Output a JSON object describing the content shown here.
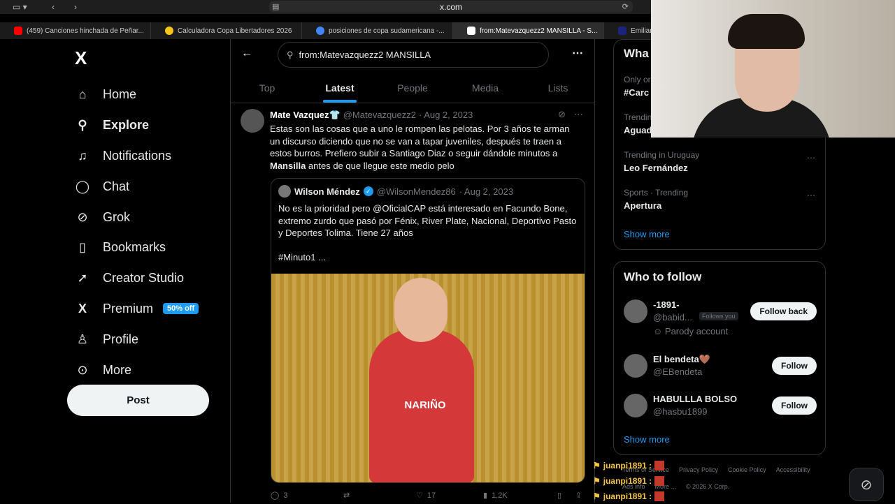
{
  "browser": {
    "url": "x.com",
    "tabs": [
      {
        "label": "(459) Canciones hinchada de Peñar...",
        "color": "#ff0000"
      },
      {
        "label": "Calculadora Copa Libertadores 2026",
        "color": "#f5c518"
      },
      {
        "label": "posiciones de copa sudamericana -...",
        "color": "#4285f4"
      },
      {
        "label": "from:Matevazquezz2 MANSILLA - S...",
        "color": "#ffffff"
      },
      {
        "label": "Emiliano",
        "color": "#1a237e"
      }
    ]
  },
  "nav": {
    "logo": "X",
    "items": [
      {
        "label": "Home",
        "icon": "home-icon",
        "glyph": "⌂"
      },
      {
        "label": "Explore",
        "icon": "search-icon",
        "glyph": "⚲"
      },
      {
        "label": "Notifications",
        "icon": "bell-icon",
        "glyph": "🔔"
      },
      {
        "label": "Chat",
        "icon": "chat-icon",
        "glyph": "◯"
      },
      {
        "label": "Grok",
        "icon": "grok-icon",
        "glyph": "⊘"
      },
      {
        "label": "Bookmarks",
        "icon": "bookmark-icon",
        "glyph": "▯"
      },
      {
        "label": "Creator Studio",
        "icon": "rocket-icon",
        "glyph": "➚"
      },
      {
        "label": "Premium",
        "icon": "x-premium-icon",
        "glyph": "X"
      },
      {
        "label": "Profile",
        "icon": "profile-icon",
        "glyph": "♙"
      },
      {
        "label": "More",
        "icon": "more-icon",
        "glyph": "⋯"
      }
    ],
    "premium_badge": "50% off",
    "post_label": "Post"
  },
  "search": {
    "query": "from:Matevazquezz2 MANSILLA"
  },
  "feed_tabs": [
    "Top",
    "Latest",
    "People",
    "Media",
    "Lists"
  ],
  "tweet": {
    "name": "Mate Vazquez👕",
    "handle": "@Matevazquezz2",
    "date": "· Aug 2, 2023",
    "text": "Estas son las cosas que a uno le rompen las pelotas. Por 3 años te arman un discurso diciendo que no se van a tapar juveniles, después te traen a estos burros. Prefiero subir a Santiago Diaz o seguir dándole minutos a ",
    "highlight": "Mansilla",
    "text_end": " antes de que llegue este medio pelo",
    "quote": {
      "name": "Wilson Méndez",
      "handle": "@WilsonMendez86",
      "date": "· Aug 2, 2023",
      "text1": "No es la prioridad pero @OficialCAP está interesado en Facundo Bone, extremo zurdo que  pasó por Fénix, River Plate, Nacional, Deportivo Pasto y Deportes Tolima. Tiene 27 años",
      "text2": "#Minuto1 ...",
      "image_text": "NARIÑO"
    },
    "replies": "3",
    "likes": "17",
    "views": "1.2K"
  },
  "trends": [
    {
      "sub": "Only on",
      "name": "#Carc"
    },
    {
      "sub": "Trending",
      "name": "Aguad"
    },
    {
      "sub": "Trending in Uruguay",
      "name": "Leo Fernández"
    },
    {
      "sub": "Sports · Trending",
      "name": "Apertura"
    }
  ],
  "whats_title": "Wha",
  "show_more": "Show more",
  "who_to_follow": {
    "title": "Who to follow",
    "users": [
      {
        "name": "-1891-",
        "handle": "@babid...",
        "follows_you": "Follows you",
        "note": "Parody account",
        "button": "Follow back"
      },
      {
        "name": "El bendeta🤎",
        "handle": "@EBendeta",
        "button": "Follow"
      },
      {
        "name": "HABULLLA BOLSO",
        "handle": "@hasbu1899",
        "button": "Follow"
      }
    ]
  },
  "chat_overlay": {
    "user": "juanpi1891 :"
  },
  "footer": [
    "Terms of Service",
    "Privacy Policy",
    "Cookie Policy",
    "Accessibility",
    "Ads info",
    "More ...",
    "© 2026 X Corp."
  ]
}
